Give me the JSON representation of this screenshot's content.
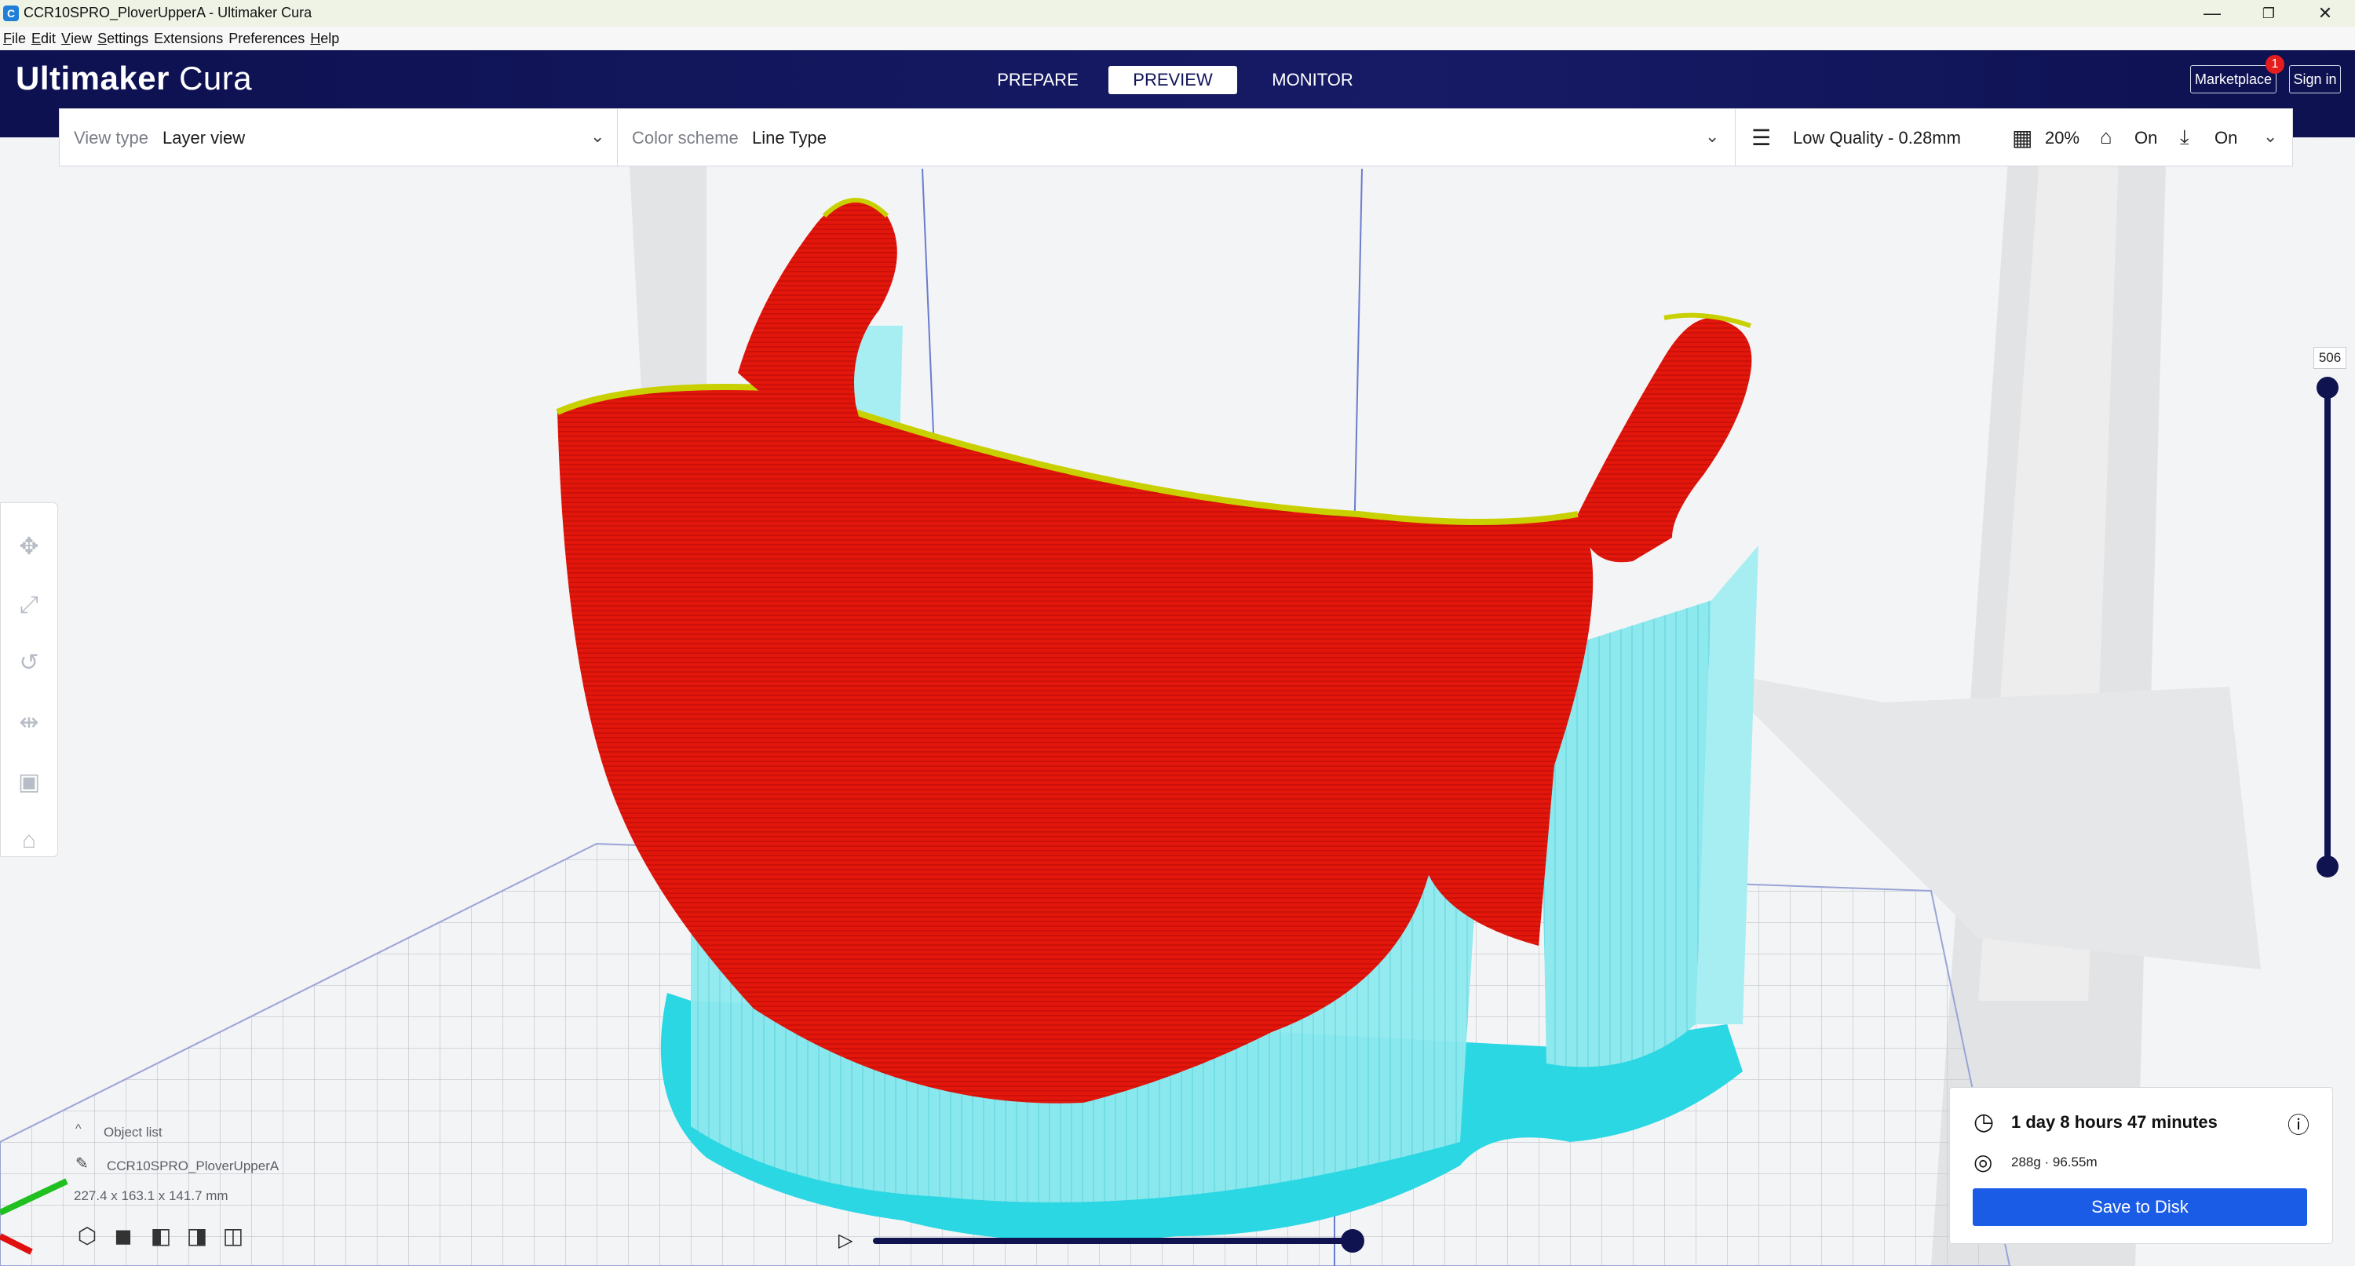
{
  "window": {
    "title": "CCR10SPRO_PloverUpperA - Ultimaker Cura",
    "app_icon": "cura-app-icon",
    "controls": [
      "minimize-icon",
      "restore-icon",
      "close-icon"
    ]
  },
  "menu": [
    {
      "u": "F",
      "rest": "ile"
    },
    {
      "u": "E",
      "rest": "dit"
    },
    {
      "u": "V",
      "rest": "iew"
    },
    {
      "u": "S",
      "rest": "ettings"
    },
    {
      "u": "",
      "rest": "Extensions"
    },
    {
      "u": "",
      "rest": "Preferences"
    },
    {
      "u": "H",
      "rest": "elp"
    }
  ],
  "header": {
    "logo_bold": "Ultimaker",
    "logo_light": " Cura",
    "tabs": [
      "PREPARE",
      "PREVIEW",
      "MONITOR"
    ],
    "active_tab": "PREVIEW",
    "marketplace": "Marketplace",
    "marketplace_badge": "1",
    "signin": "Sign in"
  },
  "toolbar": {
    "view_type_label": "View type",
    "view_type_value": "Layer view",
    "color_scheme_label": "Color scheme",
    "color_scheme_value": "Line Type",
    "quality": "Low Quality - 0.28mm",
    "infill": "20%",
    "support": "On",
    "adhesion": "On"
  },
  "left_tools": [
    "move-icon",
    "scale-icon",
    "rotate-icon",
    "mirror-icon",
    "per-model-settings-icon",
    "support-blocker-icon"
  ],
  "object_list": {
    "toggle_label": "Object list",
    "object_name": "CCR10SPRO_PloverUpperA",
    "dimensions": "227.4 x 163.1 x 141.7 mm",
    "view_buttons": [
      "3d-view-icon",
      "front-view-icon",
      "top-view-icon",
      "left-view-icon",
      "right-view-icon"
    ]
  },
  "print_info": {
    "time": "1 day 8 hours 47 minutes",
    "material": "288g · 96.55m",
    "save_button": "Save to Disk"
  },
  "layer_slider": {
    "current_layer": "506"
  },
  "colors": {
    "header": "#10145a",
    "model_wall": "#e11a0f",
    "support": "#7fe3eb",
    "support_base": "#27d9e4",
    "accent": "#1a5ce6",
    "slider": "#0f1450"
  }
}
